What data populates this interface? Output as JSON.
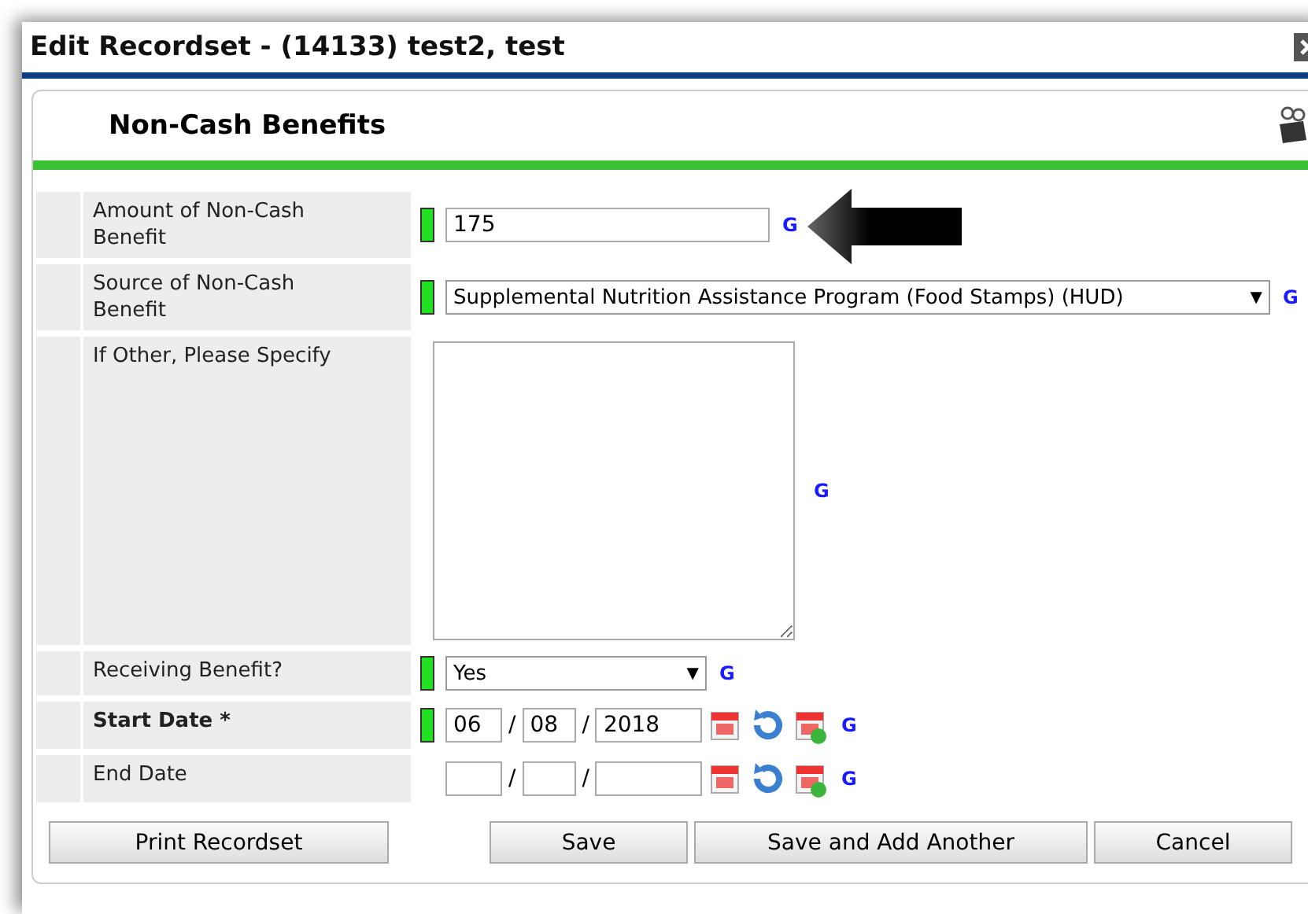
{
  "window": {
    "title": "Edit Recordset - (14133) test2, test"
  },
  "section": {
    "title": "Non-Cash Benefits"
  },
  "fields": [
    {
      "kind": "text",
      "label": "Amount of Non-Cash Benefit",
      "flagged": true,
      "value": "175",
      "link": "G",
      "pointer": true
    },
    {
      "kind": "select",
      "label": "Source of Non-Cash Benefit",
      "flagged": true,
      "value": "Supplemental Nutrition Assistance Program (Food Stamps) (HUD)",
      "caret": "▼",
      "link": "G"
    },
    {
      "kind": "textarea",
      "label": "If Other, Please Specify",
      "flagged": false,
      "link": "G"
    },
    {
      "kind": "select",
      "label": "Receiving Benefit?",
      "flagged": true,
      "value": "Yes",
      "caret": "▼",
      "link": "G"
    },
    {
      "kind": "date",
      "label": "Start Date",
      "required_mark": "*",
      "flagged": true,
      "month": "06",
      "day": "08",
      "year": "2018",
      "separators": [
        "/",
        "/"
      ],
      "link": "G"
    },
    {
      "kind": "date",
      "label": "End Date",
      "flagged": false,
      "separators": [
        "/",
        "/"
      ],
      "link": "G"
    }
  ],
  "buttons": [
    "Print Recordset",
    "Save",
    "Save and Add Another",
    "Cancel"
  ]
}
